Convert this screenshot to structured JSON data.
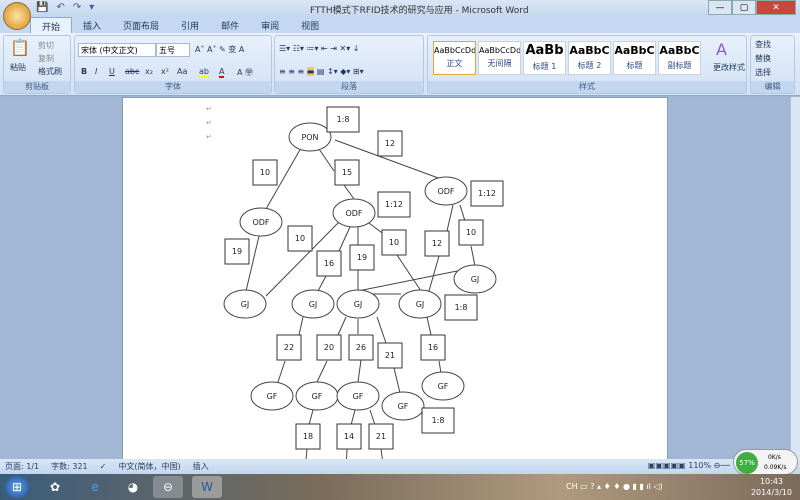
{
  "window": {
    "title": "FTTH模式下RFID技术的研究与应用 - Microsoft Word",
    "minimize": "—",
    "maximize": "▢",
    "close": "✕"
  },
  "tabs": [
    "开始",
    "插入",
    "页面布局",
    "引用",
    "邮件",
    "审阅",
    "视图"
  ],
  "clipboard": {
    "paste": "粘贴",
    "cut": "剪切",
    "copy": "复制",
    "format_painter": "格式刷",
    "label": "剪贴板"
  },
  "font": {
    "name": "宋体 (中文正文)",
    "size": "五号",
    "label": "字体",
    "bold": "B",
    "italic": "I",
    "underline": "U",
    "strike": "abc",
    "sub": "x₂",
    "sup": "x²",
    "case": "Aa"
  },
  "paragraph": {
    "label": "段落"
  },
  "styles": {
    "label": "样式",
    "items": [
      {
        "sample": "AaBbCcDd",
        "name": "正文"
      },
      {
        "sample": "AaBbCcDd",
        "name": "无间隔"
      },
      {
        "sample": "AaBb",
        "name": "标题 1"
      },
      {
        "sample": "AaBbC",
        "name": "标题 2"
      },
      {
        "sample": "AaBbC",
        "name": "标题"
      },
      {
        "sample": "AaBbC",
        "name": "副标题"
      }
    ],
    "change": "更改样式"
  },
  "editing": {
    "label": "编辑",
    "find": "查找",
    "replace": "替换",
    "select": "选择"
  },
  "diagram": {
    "nodes": [
      "PON",
      "ODF",
      "ODF",
      "ODF",
      "GJ",
      "GJ",
      "GJ",
      "GJ",
      "GJ",
      "GF",
      "GF",
      "GF",
      "GF",
      "GF"
    ],
    "boxes": [
      "1:8",
      "12",
      "10",
      "15",
      "1:12",
      "1:12",
      "10",
      "19",
      "16",
      "19",
      "10",
      "12",
      "10",
      "1:8",
      "22",
      "20",
      "26",
      "21",
      "16",
      "1:8",
      "18",
      "14",
      "21"
    ]
  },
  "status": {
    "page": "页面: 1/1",
    "words": "字数: 321",
    "lang": "中文(简体，中国)",
    "mode": "插入",
    "zoom": "110%"
  },
  "network": {
    "percent": "57%",
    "up": "0K/s",
    "down": "0.09K/s"
  },
  "taskbar": {
    "lang": "CH",
    "time": "10:43",
    "date": "2014/3/10"
  }
}
